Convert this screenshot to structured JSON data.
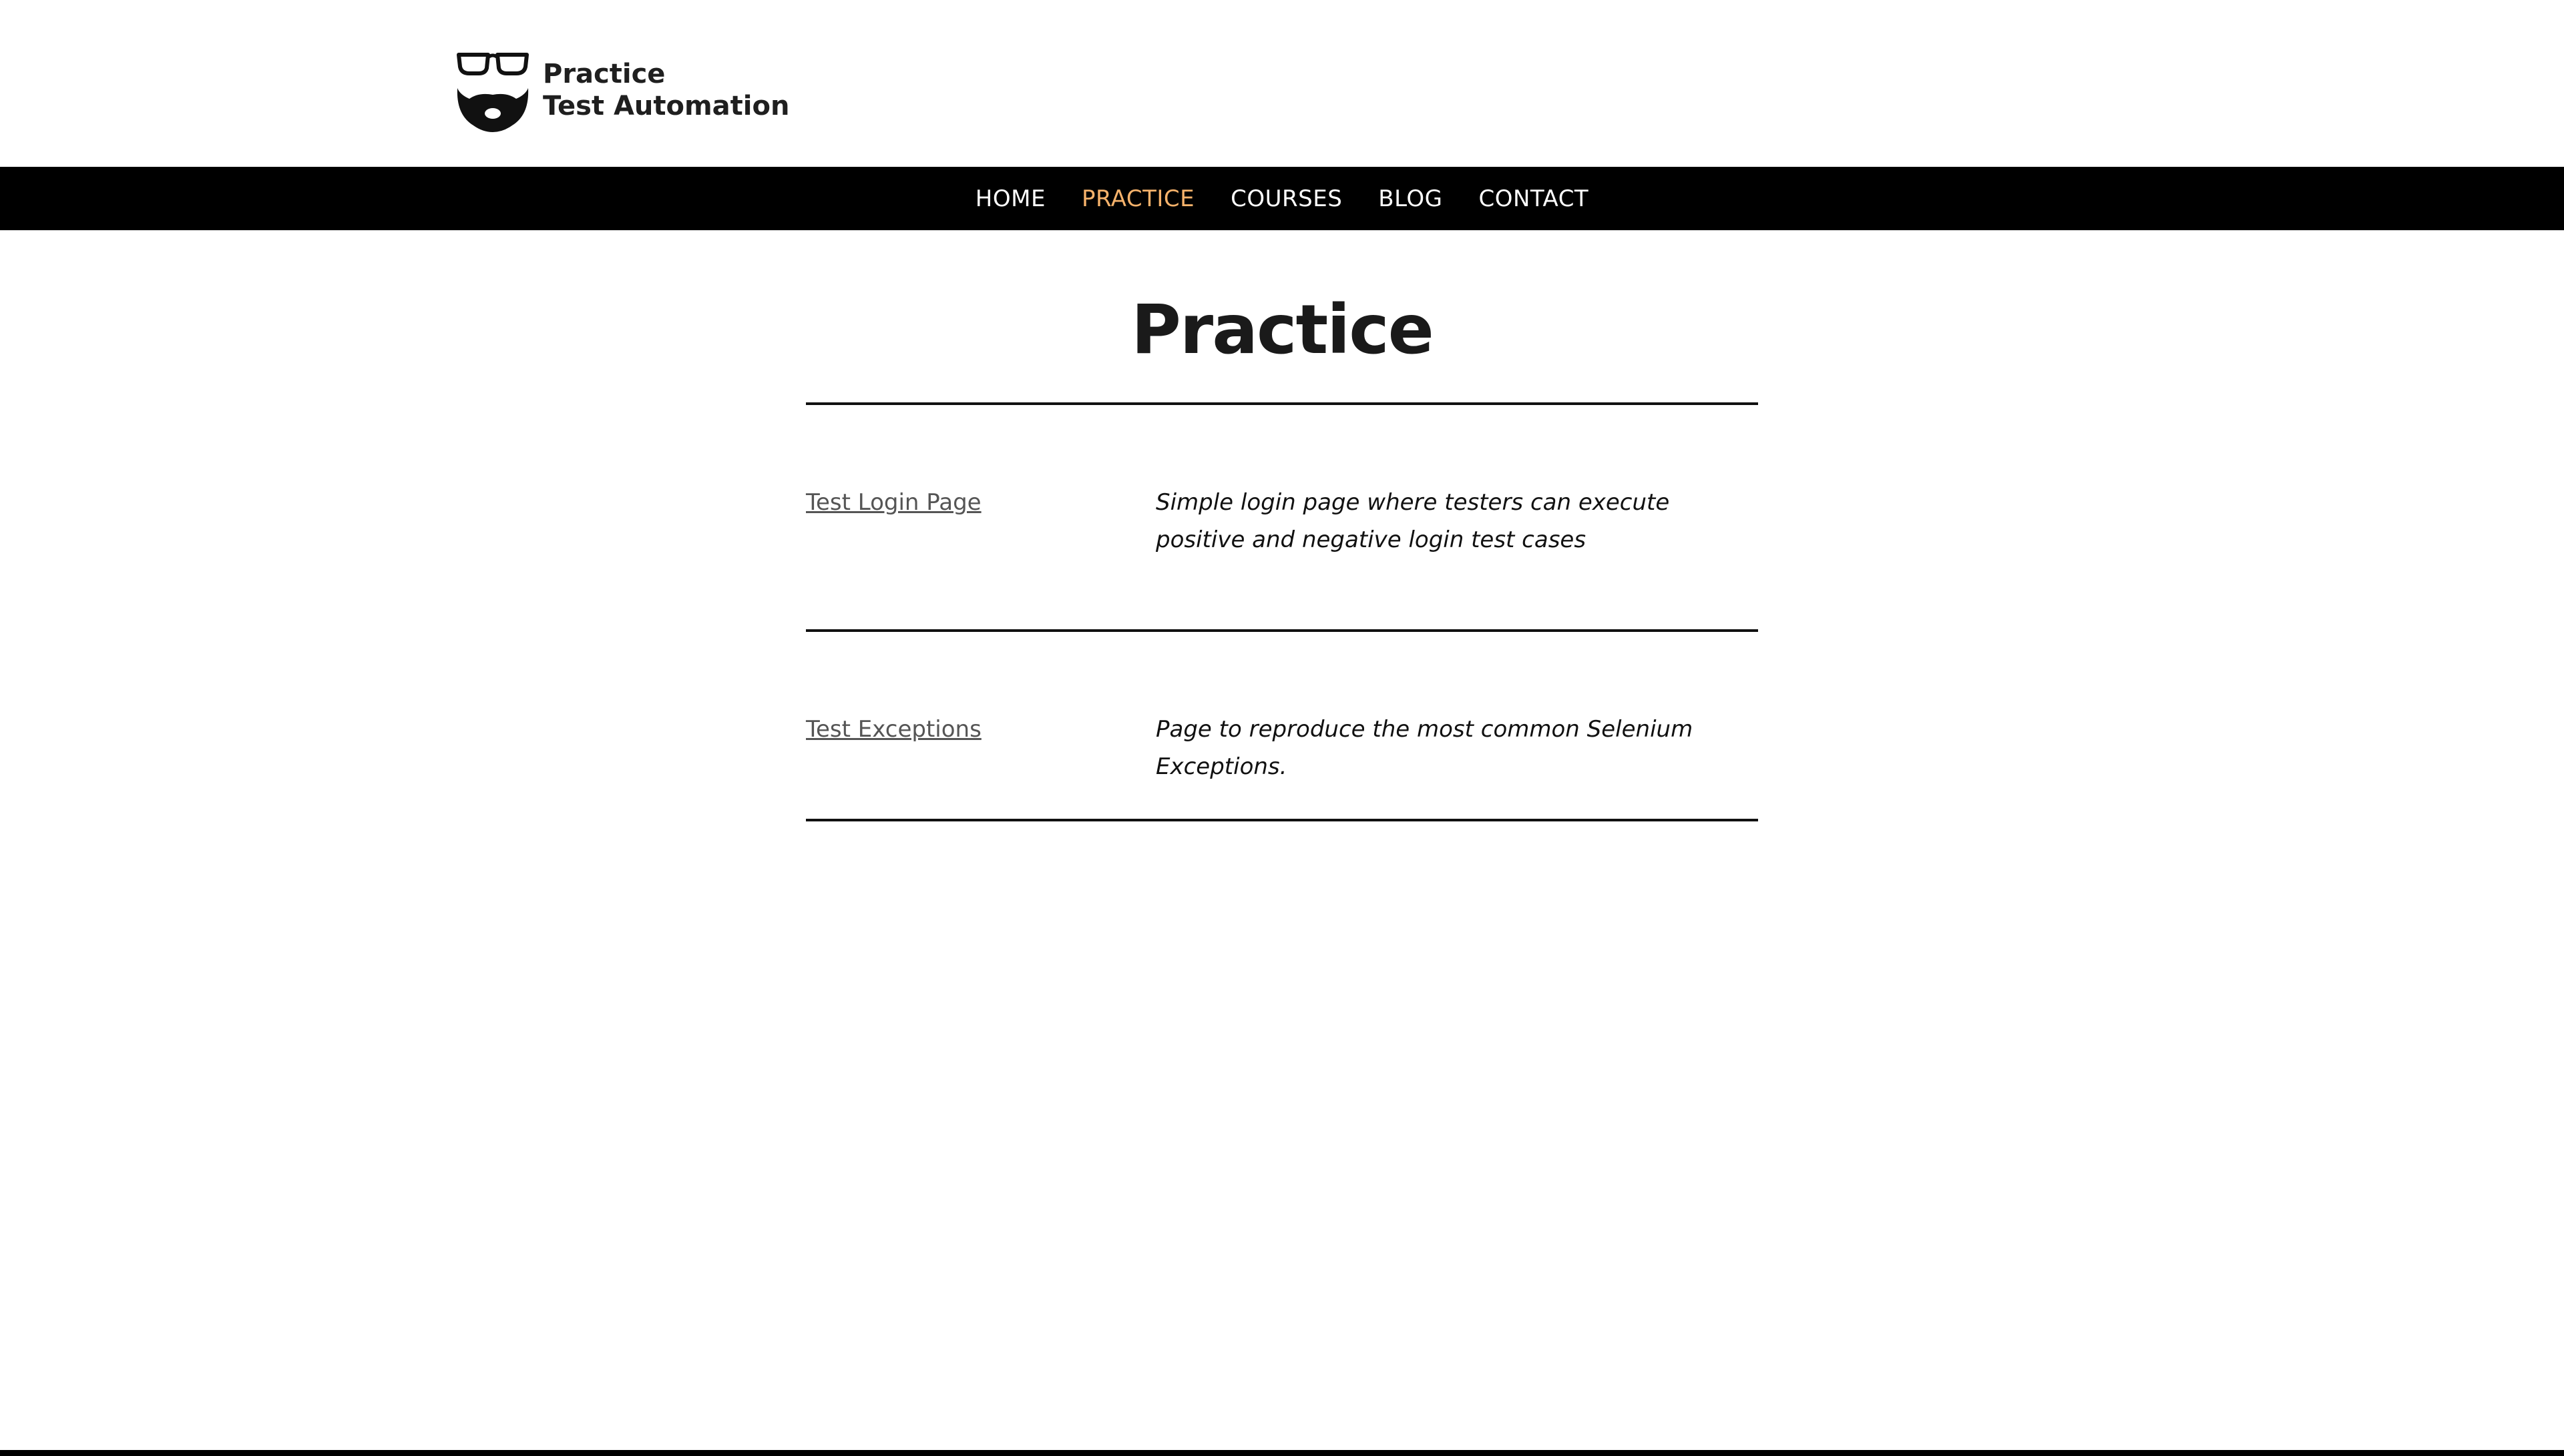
{
  "header": {
    "logo": {
      "line1": "Practice",
      "line2": "Test Automation",
      "icon": "glasses-beard-icon"
    }
  },
  "nav": {
    "items": [
      {
        "label": "HOME",
        "active": false
      },
      {
        "label": "PRACTICE",
        "active": true
      },
      {
        "label": "COURSES",
        "active": false
      },
      {
        "label": "BLOG",
        "active": false
      },
      {
        "label": "CONTACT",
        "active": false
      }
    ],
    "active_color": "#f6b26b"
  },
  "main": {
    "title": "Practice",
    "rows": [
      {
        "link": "Test Login Page",
        "description": "Simple login page where testers can execute positive and negative login test cases"
      },
      {
        "link": "Test Exceptions",
        "description": "Page to reproduce the most common Selenium Exceptions."
      }
    ]
  }
}
